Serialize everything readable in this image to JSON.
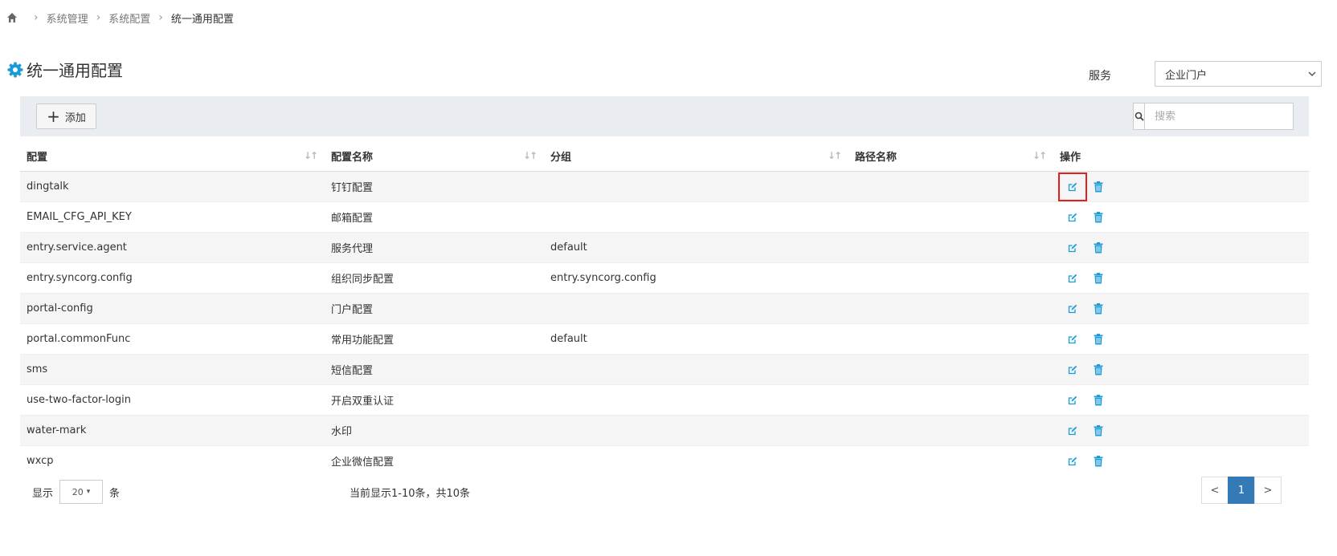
{
  "breadcrumb": {
    "home_icon": "home-icon",
    "items": [
      "系统管理",
      "系统配置",
      "统一通用配置"
    ]
  },
  "page": {
    "title": "统一通用配置",
    "title_icon": "gear-icon"
  },
  "service": {
    "label": "服务",
    "selected": "企业门户"
  },
  "toolbar": {
    "add_label": "添加",
    "search_placeholder": "搜索"
  },
  "table": {
    "columns": [
      "配置",
      "配置名称",
      "分组",
      "路径名称",
      "操作"
    ],
    "rows": [
      {
        "config": "dingtalk",
        "name": "钉钉配置",
        "group": "",
        "path": ""
      },
      {
        "config": "EMAIL_CFG_API_KEY",
        "name": "邮箱配置",
        "group": "",
        "path": ""
      },
      {
        "config": "entry.service.agent",
        "name": "服务代理",
        "group": "default",
        "path": ""
      },
      {
        "config": "entry.syncorg.config",
        "name": "组织同步配置",
        "group": "entry.syncorg.config",
        "path": ""
      },
      {
        "config": "portal-config",
        "name": "门户配置",
        "group": "",
        "path": ""
      },
      {
        "config": "portal.commonFunc",
        "name": "常用功能配置",
        "group": "default",
        "path": ""
      },
      {
        "config": "sms",
        "name": "短信配置",
        "group": "",
        "path": ""
      },
      {
        "config": "use-two-factor-login",
        "name": "开启双重认证",
        "group": "",
        "path": ""
      },
      {
        "config": "water-mark",
        "name": "水印",
        "group": "",
        "path": ""
      },
      {
        "config": "wxcp",
        "name": "企业微信配置",
        "group": "",
        "path": ""
      }
    ]
  },
  "footer": {
    "show_label": "显示",
    "page_size": "20",
    "unit_label": "条",
    "info": "当前显示1-10条，共10条",
    "prev": "<",
    "current_page": "1",
    "next": ">"
  },
  "colors": {
    "accent": "#1a9bd7",
    "highlight": "#e02020",
    "pager_active": "#337ab7"
  }
}
